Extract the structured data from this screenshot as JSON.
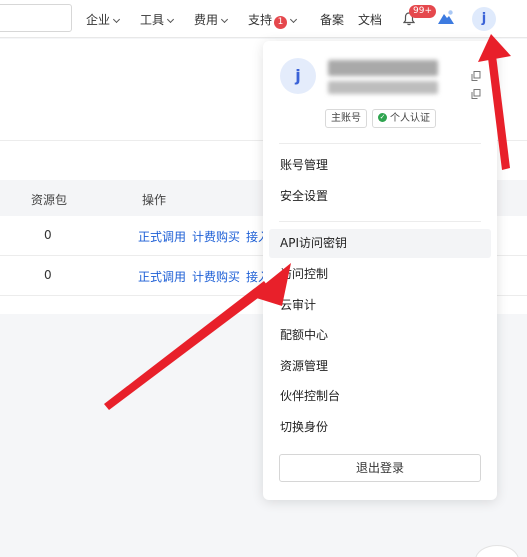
{
  "nav": {
    "items": [
      {
        "label": "企业",
        "dropdown": true
      },
      {
        "label": "工具",
        "dropdown": true
      },
      {
        "label": "费用",
        "dropdown": true
      },
      {
        "label": "支持",
        "dropdown": true,
        "badge": "1"
      },
      {
        "label": "备案",
        "dropdown": false
      },
      {
        "label": "文档",
        "dropdown": false
      }
    ],
    "notifications_badge": "99+",
    "avatar_letter": "j"
  },
  "table": {
    "headers": [
      "资源包",
      "操作"
    ],
    "rows": [
      {
        "count": "0",
        "actions": [
          "正式调用",
          "计费购买",
          "接入"
        ]
      },
      {
        "count": "0",
        "actions": [
          "正式调用",
          "计费购买",
          "接入"
        ]
      }
    ]
  },
  "account_menu": {
    "avatar_letter": "j",
    "tags": [
      "主账号",
      "个人认证"
    ],
    "menu_group_1": [
      "账号管理",
      "安全设置"
    ],
    "menu_group_2": [
      "API访问密钥",
      "访问控制",
      "云审计",
      "配额中心",
      "资源管理",
      "伙伴控制台",
      "切换身份"
    ],
    "highlighted_item": "API访问密钥",
    "logout_label": "退出登录"
  },
  "colors": {
    "accent": "#1d5fd6",
    "annotation_arrow": "#e8202a",
    "badge": "#e5484d",
    "verified": "#2ea44f"
  }
}
